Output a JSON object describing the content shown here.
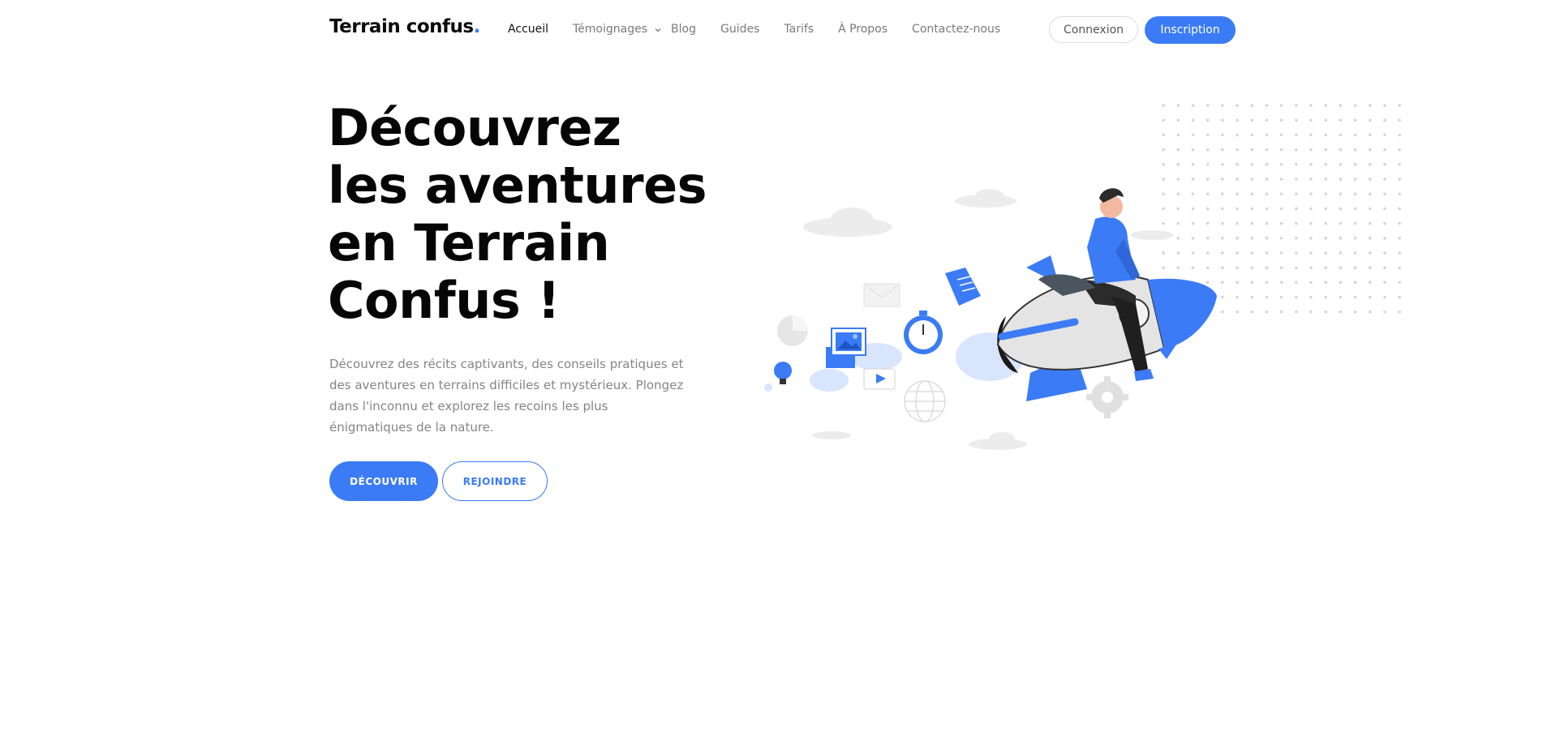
{
  "brand": {
    "name": "Terrain confus",
    "dot": "."
  },
  "nav": {
    "items": [
      {
        "label": "Accueil",
        "active": true
      },
      {
        "label": "Témoignages",
        "dropdown": true
      },
      {
        "label": "Blog"
      },
      {
        "label": "Guides"
      },
      {
        "label": "Tarifs"
      },
      {
        "label": "À Propos"
      },
      {
        "label": "Contactez-nous"
      }
    ],
    "login_label": "Connexion",
    "signup_label": "Inscription"
  },
  "hero": {
    "title_lines": [
      "Découvrez",
      "les aventures",
      "en Terrain",
      "Confus !"
    ],
    "description": "Découvrez des récits captivants, des conseils pratiques et des aventures en terrains difficiles et mystérieux. Plongez dans l'inconnu et explorez les recoins les plus énigmatiques de la nature.",
    "primary_cta": "DÉCOUVRIR",
    "secondary_cta": "REJOINDRE"
  },
  "icons": {
    "dropdown": "chevron-down-icon"
  },
  "colors": {
    "accent": "#3b7bf6",
    "text": "#060606",
    "muted": "#858585"
  }
}
